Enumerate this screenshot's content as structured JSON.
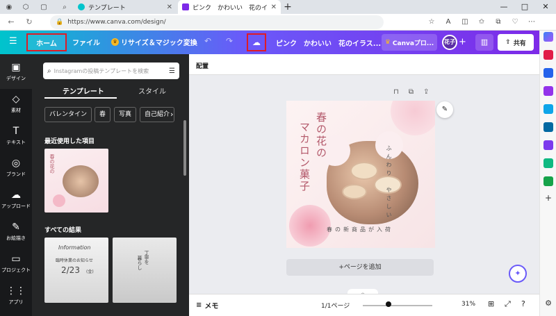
{
  "browser": {
    "tabs": [
      {
        "title": "テンプレート",
        "active": false
      },
      {
        "title": "ピンク　かわいい　花のイラスト　春",
        "active": true
      }
    ],
    "url": "https://www.canva.com/design/",
    "new_tab": "+",
    "window_controls": [
      "—",
      "□",
      "✕"
    ]
  },
  "header": {
    "home": "ホーム",
    "file": "ファイル",
    "resize": "リサイズ＆マジック変換",
    "doc_title": "ピンク　かわいい　花のイラス...",
    "pro": "Canvaプロ...",
    "avatar": "花子",
    "share": "共有"
  },
  "rail": [
    {
      "label": "デザイン",
      "icon": "▣"
    },
    {
      "label": "素材",
      "icon": "◇"
    },
    {
      "label": "テキスト",
      "icon": "T"
    },
    {
      "label": "ブランド",
      "icon": "◎"
    },
    {
      "label": "アップロード",
      "icon": "☁"
    },
    {
      "label": "お絵描き",
      "icon": "✎"
    },
    {
      "label": "プロジェクト",
      "icon": "▭"
    },
    {
      "label": "アプリ",
      "icon": "⋮⋮"
    }
  ],
  "panel": {
    "search_placeholder": "Instagramの投稿テンプレートを検索",
    "tabs": [
      "テンプレート",
      "スタイル"
    ],
    "chips": [
      "バレンタイン",
      "春",
      "写真",
      "自己紹介"
    ],
    "recent_heading": "最近使用した項目",
    "results_heading": "すべての結果",
    "thumb_a": {
      "line1": "Information",
      "line2": "臨時休業のお知らせ",
      "line3": "2/23",
      "line4": "(金)"
    },
    "thumb_b": {
      "line1": "丁寧を",
      "line2": "暮らし"
    }
  },
  "canvas": {
    "position_label": "配置",
    "design": {
      "title_col1": "春の花の",
      "title_col2": "マカロン菓子",
      "arc_text": "ふんわり　やさしい",
      "subtitle": "春の新商品が入荷"
    },
    "add_page": "+ページを追加"
  },
  "bottombar": {
    "memo": "メモ",
    "pages": "1/1ページ",
    "zoom": "31%"
  },
  "colors": {
    "accent_start": "#00c4cc",
    "accent_end": "#7d2ae8",
    "highlight": "#e01b24",
    "design_text": "#b3586a"
  }
}
